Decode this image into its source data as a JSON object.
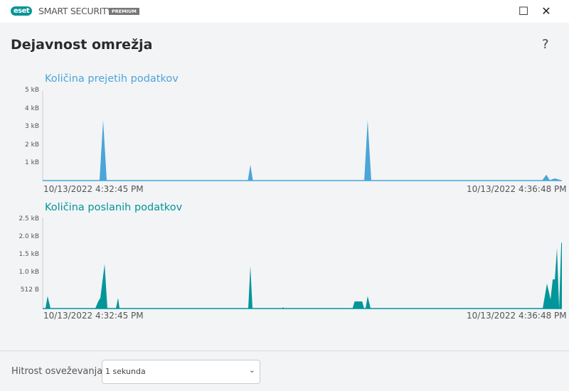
{
  "app": {
    "logo": "eset",
    "product": "SMART SECURITY",
    "edition": "PREMIUM"
  },
  "window": {
    "maximize": "☐",
    "close": "✕"
  },
  "page": {
    "title": "Dejavnost omrežja",
    "help": "?"
  },
  "chart_data": [
    {
      "type": "area",
      "title": "Količina prejetih podatkov",
      "color": "#4ba5d8",
      "unit": "kB",
      "ylim": [
        0,
        5
      ],
      "yticks": [
        {
          "v": 1,
          "label": "1 kB"
        },
        {
          "v": 2,
          "label": "2 kB"
        },
        {
          "v": 3,
          "label": "3 kB"
        },
        {
          "v": 4,
          "label": "4 kB"
        },
        {
          "v": 5,
          "label": "5 kB"
        }
      ],
      "xlim_seconds": [
        0,
        243
      ],
      "x_start_label": "10/13/2022 4:32:45 PM",
      "x_end_label": "10/13/2022 4:36:48 PM",
      "points": [
        [
          0,
          0
        ],
        [
          26.6,
          0
        ],
        [
          28.3,
          3.4
        ],
        [
          30,
          0
        ],
        [
          34.5,
          0
        ],
        [
          35,
          0.05
        ],
        [
          35.5,
          0
        ],
        [
          96,
          0
        ],
        [
          97.2,
          0.95
        ],
        [
          98.4,
          0
        ],
        [
          112,
          0
        ],
        [
          112.5,
          0.05
        ],
        [
          113,
          0
        ],
        [
          150.5,
          0
        ],
        [
          152.1,
          3.4
        ],
        [
          153.8,
          0
        ],
        [
          233.7,
          0
        ],
        [
          235.7,
          0.4
        ],
        [
          237.3,
          0.1
        ],
        [
          239.7,
          0.2
        ],
        [
          241.3,
          0.15
        ],
        [
          243,
          0
        ]
      ]
    },
    {
      "type": "area",
      "title": "Količina poslanih podatkov",
      "color": "#00969a",
      "unit": "kB",
      "ylim": [
        0,
        2.5
      ],
      "yticks": [
        {
          "v": 0.5,
          "label": "512 B"
        },
        {
          "v": 1,
          "label": "1.0 kB"
        },
        {
          "v": 1.5,
          "label": "1.5 kB"
        },
        {
          "v": 2,
          "label": "2.0 kB"
        },
        {
          "v": 2.5,
          "label": "2.5 kB"
        }
      ],
      "xlim_seconds": [
        0,
        243
      ],
      "x_start_label": "10/13/2022 4:32:45 PM",
      "x_end_label": "10/13/2022 4:36:48 PM",
      "points": [
        [
          0,
          0
        ],
        [
          1.3,
          0
        ],
        [
          2.3,
          0.35
        ],
        [
          3.7,
          0
        ],
        [
          24.6,
          0
        ],
        [
          26,
          0.2
        ],
        [
          27,
          0.3
        ],
        [
          29,
          1.25
        ],
        [
          30.3,
          0
        ],
        [
          34.3,
          0
        ],
        [
          35.3,
          0.3
        ],
        [
          36,
          0
        ],
        [
          96.2,
          0
        ],
        [
          97.2,
          1.2
        ],
        [
          98.2,
          0
        ],
        [
          112,
          0
        ],
        [
          112.5,
          0.04
        ],
        [
          113,
          0
        ],
        [
          145,
          0
        ],
        [
          146,
          0.2
        ],
        [
          149.5,
          0.2
        ],
        [
          150.5,
          0
        ],
        [
          151.1,
          0
        ],
        [
          152.1,
          0.35
        ],
        [
          153.5,
          0
        ],
        [
          234,
          0
        ],
        [
          236,
          0.7
        ],
        [
          237.7,
          0.26
        ],
        [
          238.7,
          0.82
        ],
        [
          239.7,
          0.82
        ],
        [
          240.7,
          1.7
        ],
        [
          241.7,
          0
        ],
        [
          242.7,
          1.85
        ],
        [
          243,
          1.85
        ],
        [
          243,
          0
        ]
      ]
    }
  ],
  "footer": {
    "label": "Hitrost osveževanja",
    "select_value": "1 sekunda",
    "chevron": "⌄"
  }
}
